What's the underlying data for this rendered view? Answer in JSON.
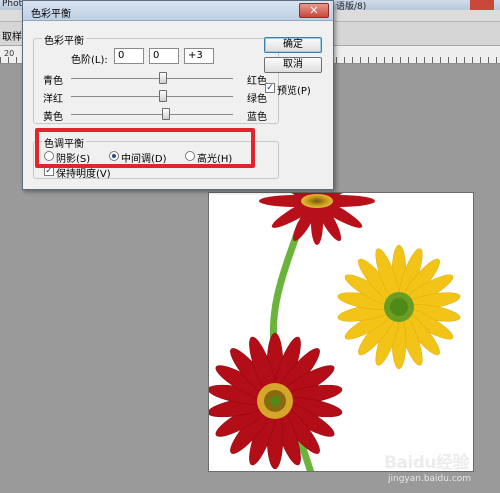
{
  "app": {
    "title_fragment": "Photo",
    "title_fragment_right": "语版/8)",
    "options_fragment": "取样大",
    "ruler_numbers": [
      "20"
    ]
  },
  "dialog": {
    "title": "色彩平衡",
    "close_glyph": "✕",
    "balance_group": {
      "legend": "色彩平衡",
      "levels_label": "色阶(L):",
      "levels": [
        "0",
        "0",
        "+3"
      ],
      "sliders": [
        {
          "left": "青色",
          "right": "红色",
          "value": 0
        },
        {
          "left": "洋红",
          "right": "绿色",
          "value": 0
        },
        {
          "left": "黄色",
          "right": "蓝色",
          "value": 3
        }
      ]
    },
    "tone_group": {
      "legend": "色调平衡",
      "options": [
        {
          "label": "阴影(S)",
          "selected": false
        },
        {
          "label": "中间调(D)",
          "selected": true
        },
        {
          "label": "高光(H)",
          "selected": false
        }
      ],
      "preserve_luminosity": {
        "label": "保持明度(V)",
        "checked": true
      }
    },
    "buttons": {
      "ok": "确定",
      "cancel": "取消"
    },
    "preview": {
      "label": "预览(P)",
      "checked": true
    }
  },
  "watermark": {
    "logo": "Baidu经验",
    "sub": "jingyan.baidu.com"
  },
  "colors": {
    "highlight": "#e0262c",
    "red_flower": "#b8101b",
    "yellow_flower": "#f2c418",
    "stem": "#6ab43c"
  }
}
